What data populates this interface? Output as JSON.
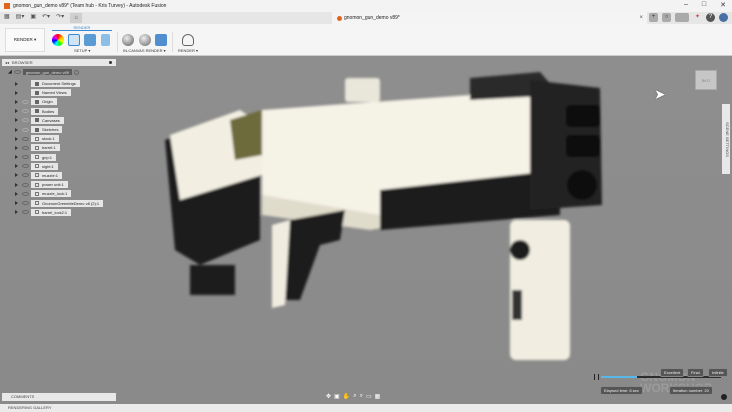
{
  "window": {
    "title": "gnomon_gun_demo v89* (Team hub - Kris Turvey) - Autodesk Fusion",
    "minimize": "–",
    "maximize": "□",
    "close": "✕"
  },
  "doc_tab": {
    "label": "gnomon_gun_demo v89*",
    "close": "×"
  },
  "toolbar": {
    "workspace": "RENDER ▾",
    "active_tab": "RENDER",
    "groups": [
      "SETUP ▾",
      "IN-CANVAS RENDER ▾",
      "RENDER ▾"
    ]
  },
  "browser": {
    "title": "BROWSER",
    "root": "gnomon_gun_demo v89",
    "items": [
      {
        "label": "Document Settings",
        "type": "gear",
        "eye": false
      },
      {
        "label": "Named Views",
        "type": "folder",
        "eye": false
      },
      {
        "label": "Origin",
        "type": "folder",
        "eye": true,
        "dim": true
      },
      {
        "label": "Bodies",
        "type": "folder",
        "eye": true,
        "dim": true
      },
      {
        "label": "Canvases",
        "type": "folder",
        "eye": true,
        "dim": true
      },
      {
        "label": "Sketches",
        "type": "folder",
        "eye": true,
        "dim": true
      },
      {
        "label": "stock:1",
        "type": "component",
        "eye": true
      },
      {
        "label": "barrel:1",
        "type": "component",
        "eye": true
      },
      {
        "label": "grip:1",
        "type": "component",
        "eye": true
      },
      {
        "label": "sight:1",
        "type": "component",
        "eye": true
      },
      {
        "label": "muzzle:1",
        "type": "component",
        "eye": true
      },
      {
        "label": "power unit:1",
        "type": "component",
        "eye": true
      },
      {
        "label": "muzzle_lock:1",
        "type": "component",
        "eye": true
      },
      {
        "label": "GnomonGreeebleDemo v8 (2):1",
        "type": "component",
        "eye": true
      },
      {
        "label": "barrel_lock2:1",
        "type": "component",
        "eye": true
      }
    ]
  },
  "scene_settings": "SCENE SETTINGS",
  "comments": "COMMENTS",
  "rendering_gallery": "RENDERING GALLERY",
  "render_progress": {
    "progress": 0.3,
    "quality_marks": [
      "Excellent",
      "Final",
      "Infinite"
    ],
    "elapsed": "Elapsed time: 8 sec",
    "iteration": "Iteration number: 20"
  },
  "watermark": "GNOMON WORKSHOP",
  "colors": {
    "accent": "#3a8ad6",
    "viewport": "#8b8b8b",
    "progress": "#5ab8e8"
  }
}
